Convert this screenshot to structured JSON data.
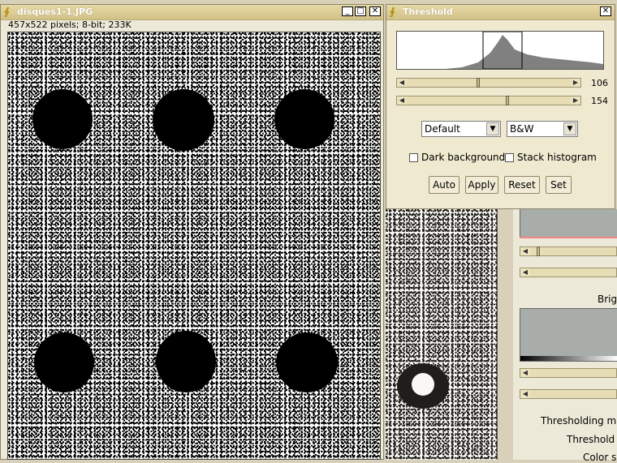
{
  "image_window": {
    "title": "disques1-1.JPG",
    "info": "457x522 pixels; 8-bit; 233K",
    "buttons": {
      "minimize": "_",
      "maximize": "□",
      "close": "✕"
    }
  },
  "threshold_dialog": {
    "title": "Threshold",
    "close": "✕",
    "lower_value": "106",
    "upper_value": "154",
    "method": "Default",
    "display_mode": "B&W",
    "dark_background_label": "Dark background",
    "stack_histogram_label": "Stack histogram",
    "buttons": {
      "auto": "Auto",
      "apply": "Apply",
      "reset": "Reset",
      "set": "Set"
    }
  },
  "right_panel": {
    "brightness_label": "Brigh",
    "thresholding_label": "Thresholding me",
    "threshold_label": "Threshold c",
    "color_label": "Color s"
  }
}
